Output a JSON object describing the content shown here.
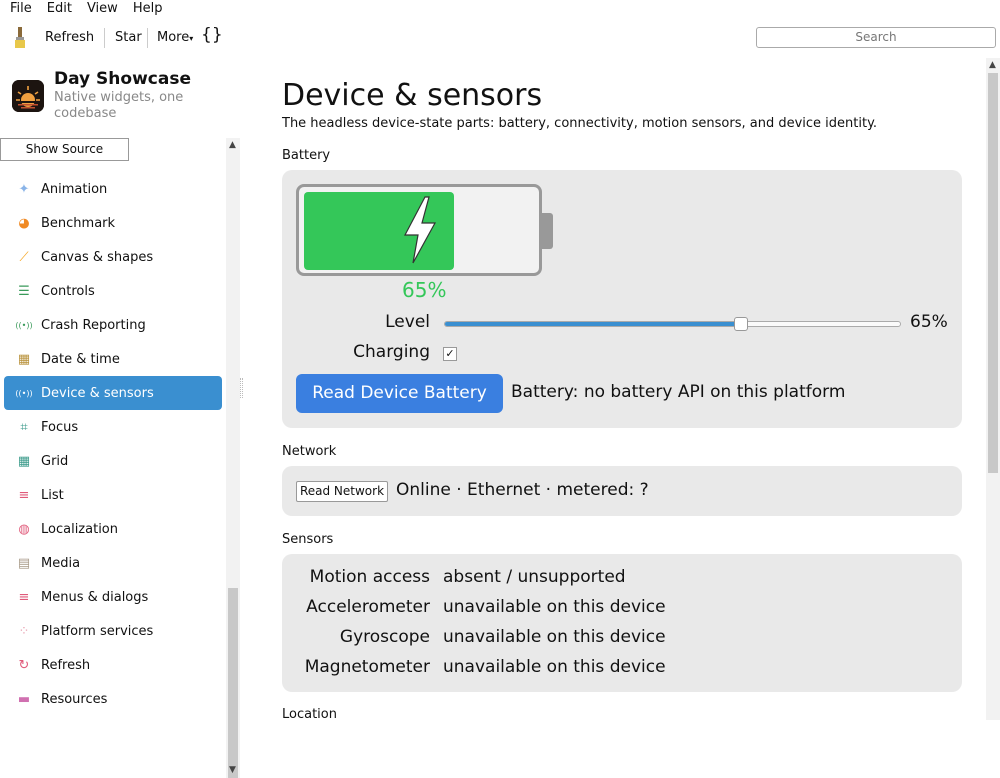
{
  "menubar": {
    "items": [
      "File",
      "Edit",
      "View",
      "Help"
    ]
  },
  "toolbar": {
    "refresh": "Refresh",
    "star": "Star",
    "more": "More",
    "braces": "{}",
    "search_placeholder": "Search"
  },
  "app": {
    "title": "Day Showcase",
    "subtitle": "Native widgets, one codebase",
    "show_source": "Show Source"
  },
  "sidebar": {
    "items": [
      {
        "label": "Animation",
        "icon": "sparkle-icon",
        "color": "#8ab4e8"
      },
      {
        "label": "Benchmark",
        "icon": "gauge-icon",
        "color": "#f08a24"
      },
      {
        "label": "Canvas & shapes",
        "icon": "brush-icon",
        "color": "#f5a623"
      },
      {
        "label": "Controls",
        "icon": "sliders-icon",
        "color": "#3a9a5a"
      },
      {
        "label": "Crash Reporting",
        "icon": "broadcast-icon",
        "color": "#3a9a5a"
      },
      {
        "label": "Date & time",
        "icon": "calendar-icon",
        "color": "#b8913a"
      },
      {
        "label": "Device & sensors",
        "icon": "broadcast-icon",
        "color": "#ffffff"
      },
      {
        "label": "Focus",
        "icon": "focus-icon",
        "color": "#3a9a8a"
      },
      {
        "label": "Grid",
        "icon": "grid-icon",
        "color": "#3a9a8a"
      },
      {
        "label": "List",
        "icon": "list-icon",
        "color": "#e05a7a"
      },
      {
        "label": "Localization",
        "icon": "globe-icon",
        "color": "#e05a7a"
      },
      {
        "label": "Media",
        "icon": "film-icon",
        "color": "#a89a88"
      },
      {
        "label": "Menus & dialogs",
        "icon": "menu-icon",
        "color": "#e05a7a"
      },
      {
        "label": "Platform services",
        "icon": "dots-icon",
        "color": "#e8a0b0"
      },
      {
        "label": "Refresh",
        "icon": "refresh-icon",
        "color": "#e05a7a"
      },
      {
        "label": "Resources",
        "icon": "folder-icon",
        "color": "#d070b0"
      }
    ],
    "active_index": 6
  },
  "main": {
    "title": "Device & sensors",
    "description": "The headless device-state parts: battery, connectivity, motion sensors, and device identity.",
    "battery": {
      "section_label": "Battery",
      "level_fraction": 0.65,
      "percent_text": "65%",
      "level_label": "Level",
      "level_value_text": "65%",
      "charging_label": "Charging",
      "charging_checked": true,
      "read_button": "Read Device Battery",
      "status": "Battery: no battery API on this platform",
      "fill_color": "#34c759"
    },
    "network": {
      "section_label": "Network",
      "read_button": "Read Network",
      "status": "Online · Ethernet · metered: ?"
    },
    "sensors": {
      "section_label": "Sensors",
      "rows": [
        {
          "label": "Motion access",
          "value": "absent / unsupported"
        },
        {
          "label": "Accelerometer",
          "value": "unavailable on this device"
        },
        {
          "label": "Gyroscope",
          "value": "unavailable on this device"
        },
        {
          "label": "Magnetometer",
          "value": "unavailable on this device"
        }
      ]
    },
    "location": {
      "section_label": "Location"
    }
  },
  "colors": {
    "accent": "#3a8fd0",
    "primary_button": "#3a7fe0",
    "battery_green": "#34c759"
  }
}
